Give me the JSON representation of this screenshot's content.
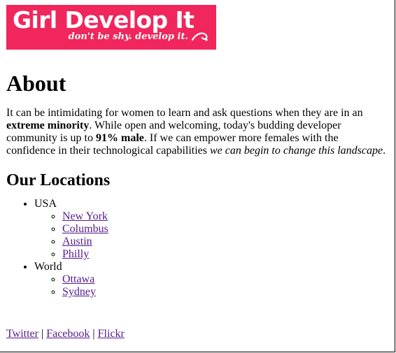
{
  "logo": {
    "title": "Girl Develop It",
    "tagline": "don't be shy. develop it.",
    "background": "#f0265c"
  },
  "heading": "About",
  "intro": {
    "part1": "It can be intimidating for women to learn and ask questions when they are in an ",
    "bold1": "extreme minority",
    "part2": ". While open and welcoming, today's budding developer community is up to ",
    "bold2": "91% male",
    "part3": ". If we can empower more females with the confidence in their technological capabilities ",
    "italic": "we can begin to change this landscape",
    "part4": "."
  },
  "locations_heading": "Our Locations",
  "regions": [
    {
      "name": "USA",
      "cities": [
        "New York",
        "Columbus",
        "Austin",
        "Philly"
      ]
    },
    {
      "name": "World",
      "cities": [
        "Ottawa",
        "Sydney"
      ]
    }
  ],
  "footer": {
    "twitter": "Twitter",
    "facebook": "Facebook",
    "flickr": "Flickr",
    "separator": "|"
  },
  "colors": {
    "link": "#551a8b",
    "brand": "#f0265c"
  }
}
